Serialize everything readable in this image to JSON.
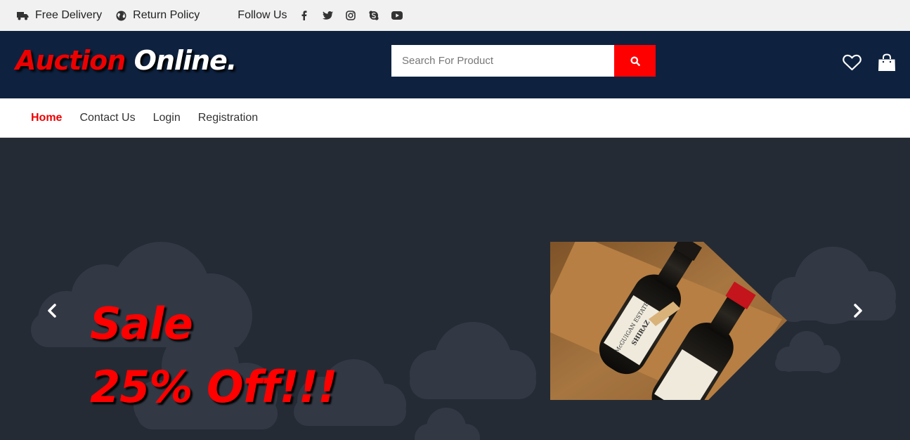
{
  "topbar": {
    "free_delivery": "Free Delivery",
    "return_policy": "Return Policy",
    "follow_us": "Follow Us",
    "social_icons": [
      "facebook-icon",
      "twitter-icon",
      "instagram-icon",
      "skype-icon",
      "youtube-icon"
    ]
  },
  "header": {
    "logo_part1": "Auction",
    "logo_part2": "Online.",
    "search_placeholder": "Search For Product",
    "icons": [
      "heart-icon",
      "shopping-bag-icon"
    ]
  },
  "nav": {
    "items": [
      "Home",
      "Contact Us",
      "Login",
      "Registration"
    ],
    "active": "Home"
  },
  "hero": {
    "line1": "Sale",
    "line2": "25% Off!!!",
    "wine_label_1": "McGUIGAN ESTATE",
    "wine_label_1_sub": "SHIRAZ"
  },
  "colors": {
    "header_bg": "#0e2240",
    "accent_red": "#ff0000",
    "hero_bg": "#252b35",
    "topbar_bg": "#f1f1f1"
  }
}
